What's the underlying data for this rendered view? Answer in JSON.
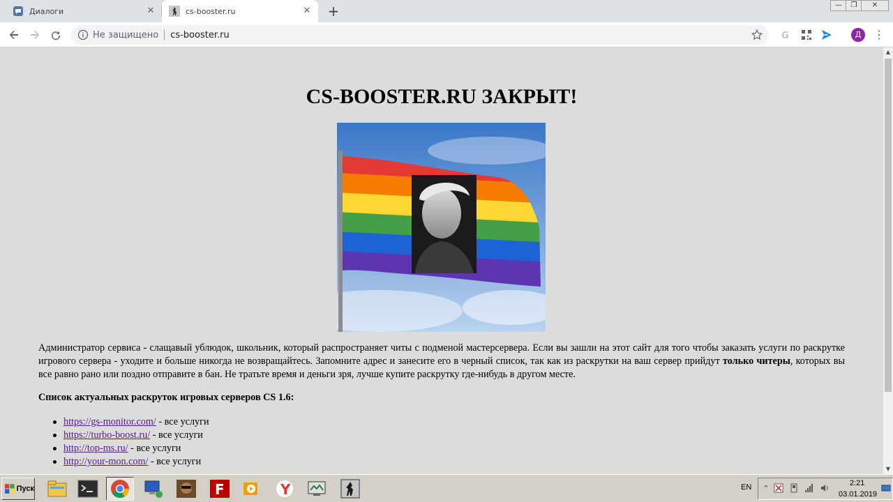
{
  "browser": {
    "tabs": [
      {
        "title": "Диалоги",
        "icon": "vk-dialogs-icon"
      },
      {
        "title": "cs-booster.ru",
        "icon": "counter-strike-icon",
        "active": true
      }
    ],
    "new_tab_symbol": "+",
    "window_controls": {
      "minimize": "—",
      "restore": "❐",
      "close": "✕"
    },
    "address_bar": {
      "security_label": "Не защищено",
      "url": "cs-booster.ru"
    },
    "profile_initial": "Д"
  },
  "page": {
    "heading": "CS-BOOSTER.RU ЗАКРЫТ!",
    "paragraph_start": "Администратор сервиса - слащавый ублюдок, школьник, который распространяет читы с подменой мастерсервера. Если вы зашли на этот сайт для того чтобы заказать услуги по раскрутке игрового сервера - уходите и больше никогда не возвращайтесь. Запомните адрес и занесите его в черный список, так как из раскрутки на ваш сервер прийдут ",
    "paragraph_bold": "только читеры",
    "paragraph_end": ", которых вы все равно рано или поздно отправите в бан. Не тратьте время и деньги зря, лучше купите раскрутку где-нибудь в другом месте.",
    "list_title": "Список актуальных раскруток игровых серверов CS 1.6:",
    "links": [
      {
        "url": "https://gs-monitor.com/",
        "suffix": " - все услуги"
      },
      {
        "url": "https://turbo-boost.ru/",
        "suffix": " - все услуги"
      },
      {
        "url": "http://top-ms.ru/",
        "suffix": " - все услуги"
      },
      {
        "url": "http://your-mon.com/",
        "suffix": " - все услуги"
      }
    ]
  },
  "taskbar": {
    "start_label": "Пуск",
    "apps": [
      "file-explorer-icon",
      "terminal-icon",
      "chrome-icon",
      "network-computer-icon",
      "game-avatar-icon",
      "filezilla-icon",
      "media-player-icon",
      "yandex-browser-icon",
      "monitor-app-icon",
      "counter-strike-icon"
    ],
    "language": "EN",
    "time": "2:21",
    "date": "03.01.2019"
  },
  "colors": {
    "page_background": "#dcdcdc",
    "link_visited": "#551a8b",
    "avatar": "#8e24aa",
    "taskbar": "#d4d0c8"
  }
}
